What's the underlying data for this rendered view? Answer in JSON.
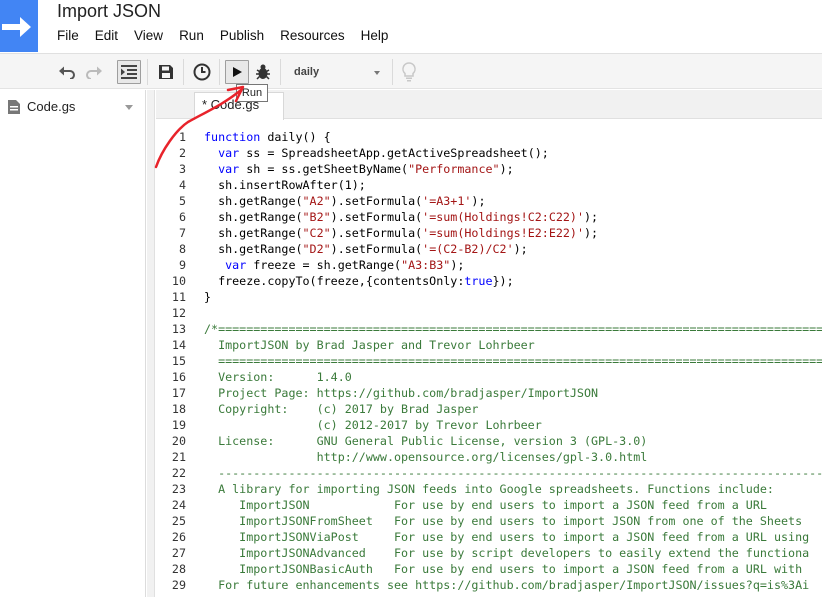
{
  "app": {
    "doc_title": "Import JSON",
    "menu": [
      "File",
      "Edit",
      "View",
      "Run",
      "Publish",
      "Resources",
      "Help"
    ]
  },
  "toolbar": {
    "function_select": "daily",
    "tooltip": "Run",
    "icons": [
      "undo-icon",
      "redo-icon",
      "indent-icon",
      "save-icon",
      "triggers-icon",
      "run-icon",
      "debug-icon",
      "lightbulb-icon"
    ]
  },
  "sidebar": {
    "file_name": "Code.gs"
  },
  "tab": {
    "label": "* Code.gs"
  },
  "editor": {
    "line_numbers": [
      "1",
      "2",
      "3",
      "4",
      "5",
      "6",
      "7",
      "8",
      "9",
      "10",
      "11",
      "12",
      "13",
      "14",
      "15",
      "16",
      "17",
      "18",
      "19",
      "20",
      "21",
      "22",
      "23",
      "24",
      "25",
      "26",
      "27",
      "28",
      "29"
    ],
    "lines": [
      "function daily() {",
      "  var ss = SpreadsheetApp.getActiveSpreadsheet();",
      "  var sh = ss.getSheetByName(\"Performance\");",
      "  sh.insertRowAfter(1);",
      "  sh.getRange(\"A2\").setFormula('=A3+1');",
      "  sh.getRange(\"B2\").setFormula('=sum(Holdings!C2:C22)');",
      "  sh.getRange(\"C2\").setFormula('=sum(Holdings!E2:E22)');",
      "  sh.getRange(\"D2\").setFormula('=(C2-B2)/C2');",
      "   var freeze = sh.getRange(\"A3:B3\");",
      "  freeze.copyTo(freeze,{contentsOnly:true});",
      "}",
      "",
      "/*====================================================================================================================",
      "  ImportJSON by Brad Jasper and Trevor Lohrbeer",
      "  ====================================================================================================================",
      "  Version:      1.4.0",
      "  Project Page: https://github.com/bradjasper/ImportJSON",
      "  Copyright:    (c) 2017 by Brad Jasper",
      "                (c) 2012-2017 by Trevor Lohrbeer",
      "  License:      GNU General Public License, version 3 (GPL-3.0)",
      "                http://www.opensource.org/licenses/gpl-3.0.html",
      "  --------------------------------------------------------------------------------------------------------------------",
      "  A library for importing JSON feeds into Google spreadsheets. Functions include:",
      "     ImportJSON            For use by end users to import a JSON feed from a URL",
      "     ImportJSONFromSheet   For use by end users to import JSON from one of the Sheets",
      "     ImportJSONViaPost     For use by end users to import a JSON feed from a URL using",
      "     ImportJSONAdvanced    For use by script developers to easily extend the functiona",
      "     ImportJSONBasicAuth   For use by end users to import a JSON feed from a URL with",
      "  For future enhancements see https://github.com/bradjasper/ImportJSON/issues?q=is%3Ai"
    ]
  },
  "colors": {
    "brand": "#4285f4",
    "keyword": "#0000ff",
    "string": "#a31515",
    "comment": "#3a7a3a",
    "annotation": "#e8232b"
  }
}
